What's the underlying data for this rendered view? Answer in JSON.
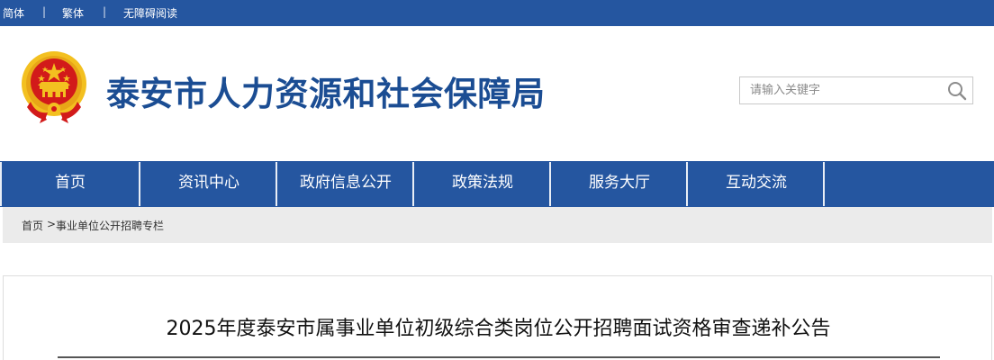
{
  "topbar": {
    "links": [
      "简体",
      "繁体",
      "无障碍阅读"
    ],
    "separator": "|"
  },
  "header": {
    "site_title": "泰安市人力资源和社会保障局",
    "emblem_icon": "national-emblem-icon",
    "search": {
      "placeholder": "请输入关键字",
      "value": "",
      "icon": "magnifier-icon"
    }
  },
  "nav": {
    "items": [
      "首页",
      "资讯中心",
      "政府信息公开",
      "政策法规",
      "服务大厅",
      "互动交流"
    ]
  },
  "breadcrumb": {
    "home": "首页",
    "separator": ">",
    "current": "事业单位公开招聘专栏"
  },
  "article": {
    "title": "2025年度泰安市属事业单位初级综合类岗位公开招聘面试资格审查递补公告"
  },
  "colors": {
    "primary_blue": "#2556a0",
    "title_blue": "#1b4d93",
    "breadcrumb_bg": "#ebebeb",
    "emblem_red": "#d21a1a",
    "emblem_gold": "#f3c020"
  }
}
